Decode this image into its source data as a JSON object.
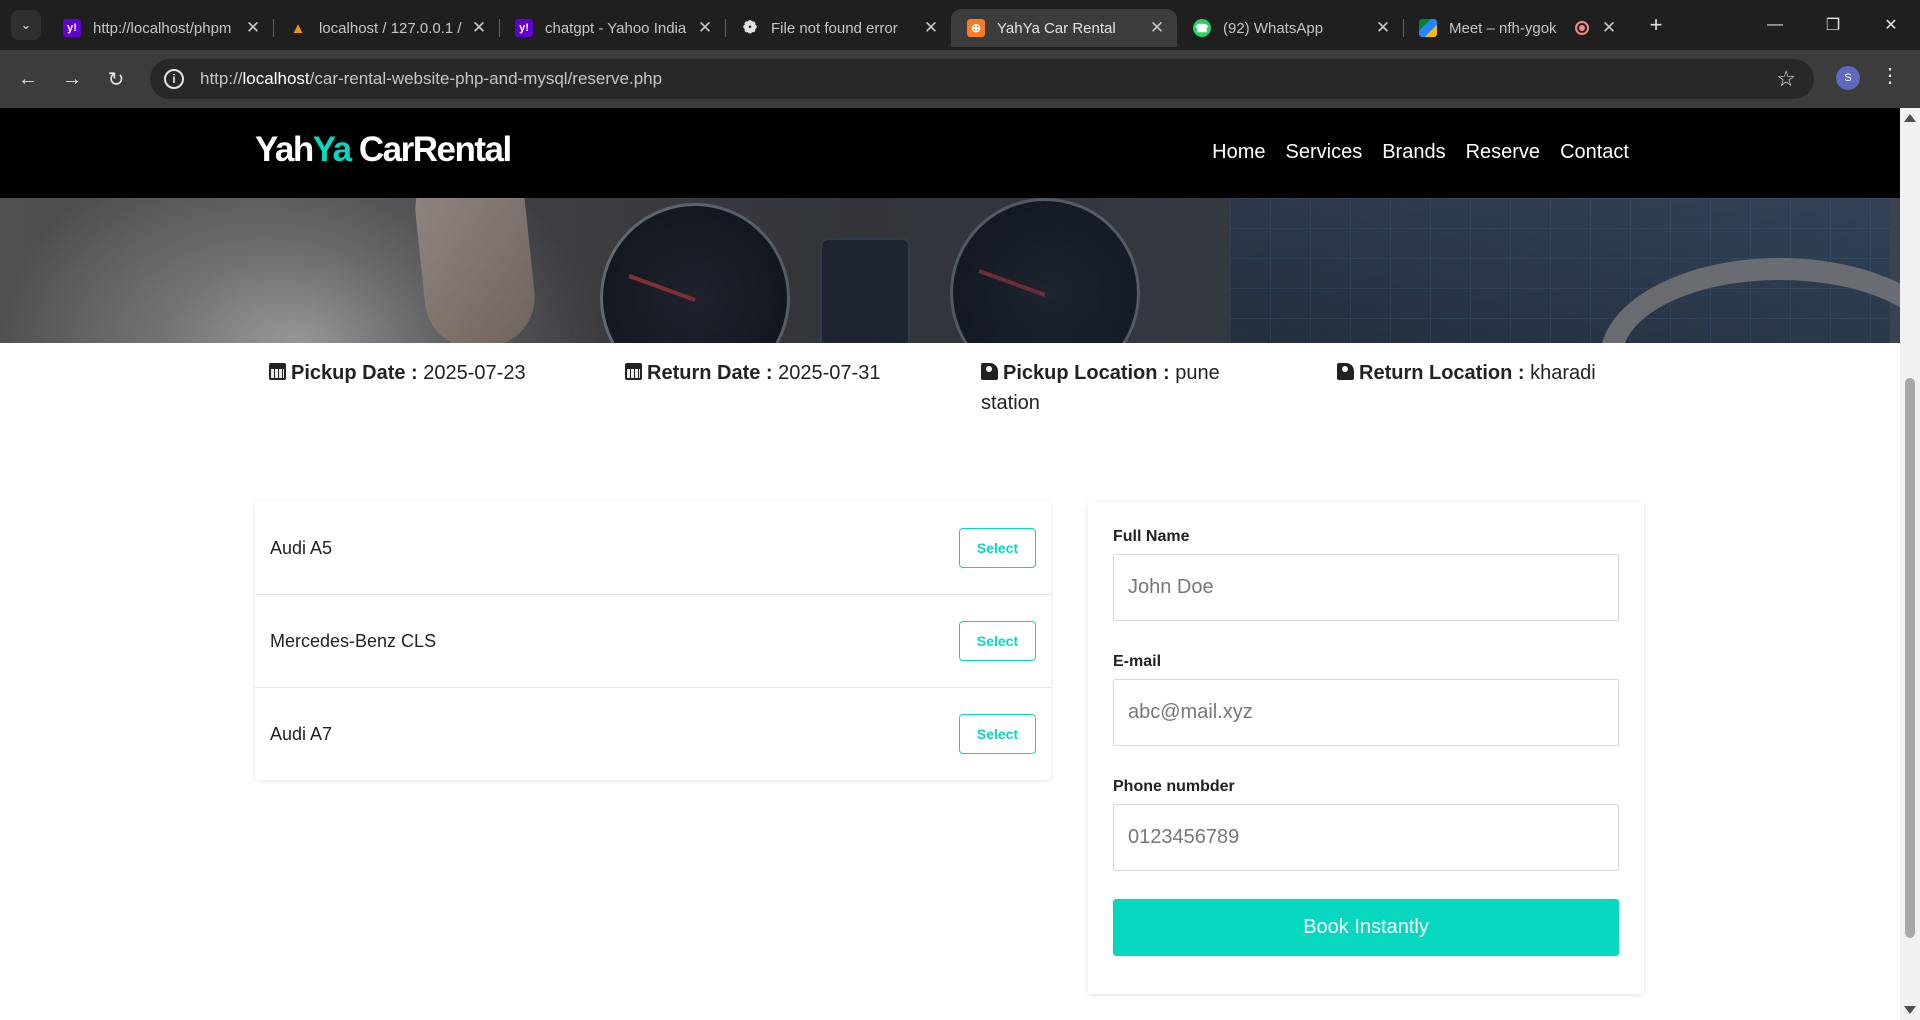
{
  "browser": {
    "tabs": [
      {
        "title": "http://localhost/phpm",
        "favicon": "yahoo-icon",
        "active": false
      },
      {
        "title": "localhost / 127.0.0.1 /",
        "favicon": "phpmyadmin-icon",
        "active": false
      },
      {
        "title": "chatgpt - Yahoo India",
        "favicon": "yahoo-icon",
        "active": false
      },
      {
        "title": "File not found error",
        "favicon": "openai-icon",
        "active": false
      },
      {
        "title": "YahYa Car Rental",
        "favicon": "xampp-icon",
        "active": true
      },
      {
        "title": "(92) WhatsApp",
        "favicon": "whatsapp-icon",
        "active": false
      },
      {
        "title": "Meet – nfh-ygok",
        "favicon": "meet-icon",
        "active": false,
        "recording": true
      }
    ],
    "url_prefix": "http://",
    "url_host": "localhost",
    "url_path": "/car-rental-website-php-and-mysql/reserve.php",
    "profile_initial": "S"
  },
  "site": {
    "logo_part1": "Yah",
    "logo_part2": "Ya",
    "logo_part3": " CarRental",
    "nav": [
      "Home",
      "Services",
      "Brands",
      "Reserve",
      "Contact"
    ]
  },
  "summary": {
    "pickup_date_label": "Pickup Date :",
    "pickup_date": "2025-07-23",
    "return_date_label": "Return Date :",
    "return_date": "2025-07-31",
    "pickup_location_label": "Pickup Location :",
    "pickup_location": "pune station",
    "return_location_label": "Return Location :",
    "return_location": "kharadi"
  },
  "cars": [
    {
      "name": "Audi A5",
      "button": "Select"
    },
    {
      "name": "Mercedes-Benz CLS",
      "button": "Select"
    },
    {
      "name": "Audi A7",
      "button": "Select"
    }
  ],
  "form": {
    "name_label": "Full Name",
    "name_placeholder": "John Doe",
    "email_label": "E-mail",
    "email_placeholder": "abc@mail.xyz",
    "phone_label": "Phone numbder",
    "phone_placeholder": "0123456789",
    "submit_label": "Book Instantly"
  },
  "colors": {
    "accent": "#06d8c0",
    "header_bg": "#000000"
  }
}
